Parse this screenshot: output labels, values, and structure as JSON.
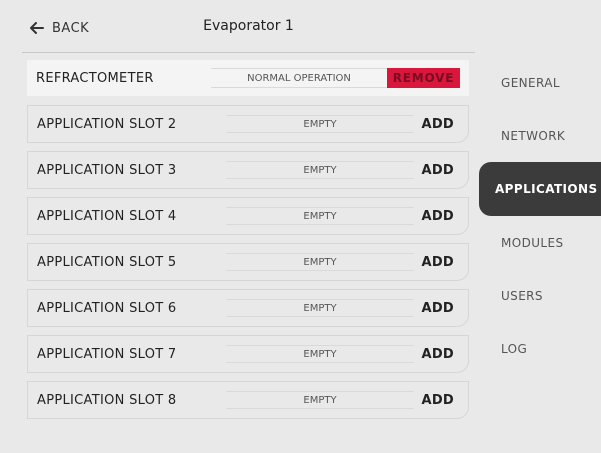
{
  "header": {
    "back_label": "BACK",
    "title": "Evaporator 1"
  },
  "applications": [
    {
      "name": "REFRACTOMETER",
      "status": "NORMAL OPERATION",
      "action": "REMOVE",
      "active": true
    },
    {
      "name": "APPLICATION SLOT 2",
      "status": "EMPTY",
      "action": "ADD"
    },
    {
      "name": "APPLICATION SLOT 3",
      "status": "EMPTY",
      "action": "ADD"
    },
    {
      "name": "APPLICATION SLOT 4",
      "status": "EMPTY",
      "action": "ADD"
    },
    {
      "name": "APPLICATION SLOT 5",
      "status": "EMPTY",
      "action": "ADD"
    },
    {
      "name": "APPLICATION SLOT 6",
      "status": "EMPTY",
      "action": "ADD"
    },
    {
      "name": "APPLICATION SLOT 7",
      "status": "EMPTY",
      "action": "ADD"
    },
    {
      "name": "APPLICATION SLOT 8",
      "status": "EMPTY",
      "action": "ADD"
    }
  ],
  "sidebar": {
    "items": [
      {
        "label": "GENERAL"
      },
      {
        "label": "NETWORK"
      },
      {
        "label": "APPLICATIONS",
        "active": true
      },
      {
        "label": "MODULES"
      },
      {
        "label": "USERS"
      },
      {
        "label": "LOG"
      }
    ]
  },
  "colors": {
    "background": "#e9e9e9",
    "active_nav": "#3b3b3b",
    "remove_button": "#d9163c"
  },
  "icons": {
    "back": "arrow-left-icon"
  }
}
